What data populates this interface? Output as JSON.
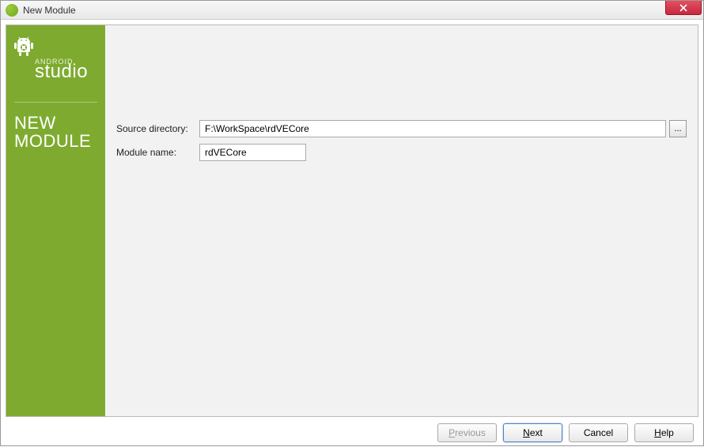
{
  "window": {
    "title": "New Module"
  },
  "sidebar": {
    "brand_small": "ANDROID",
    "brand_large": "studio",
    "heading_line1": "NEW",
    "heading_line2": "MODULE"
  },
  "fields": {
    "source_dir": {
      "label": "Source directory:",
      "value": "F:\\WorkSpace\\rdVECore"
    },
    "module_name": {
      "label": "Module name:",
      "value": "rdVECore"
    },
    "browse_label": "..."
  },
  "buttons": {
    "previous": "Previous",
    "next": "Next",
    "cancel": "Cancel",
    "help": "Help"
  }
}
